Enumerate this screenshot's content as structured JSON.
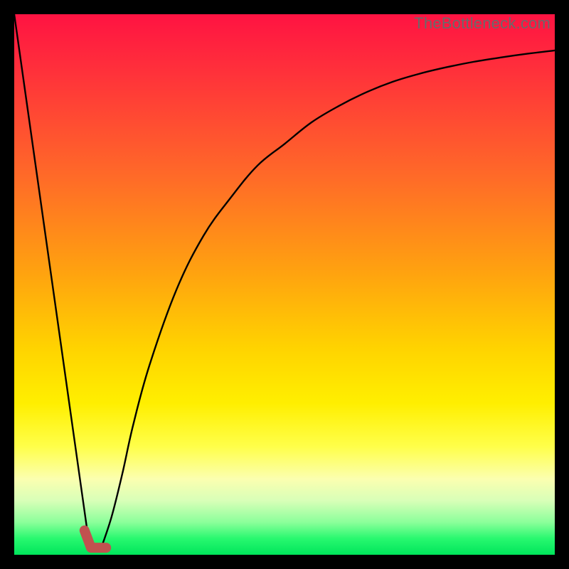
{
  "watermark": "TheBottleneck.com",
  "chart_data": {
    "type": "line",
    "title": "",
    "xlabel": "",
    "ylabel": "",
    "xlim": [
      0,
      100
    ],
    "ylim": [
      0,
      100
    ],
    "grid": false,
    "series": [
      {
        "name": "left-line",
        "x": [
          0,
          14
        ],
        "y": [
          100,
          1
        ]
      },
      {
        "name": "right-curve",
        "x": [
          16,
          18,
          20,
          22,
          25,
          30,
          35,
          40,
          45,
          50,
          55,
          60,
          65,
          70,
          75,
          80,
          85,
          90,
          95,
          100
        ],
        "y": [
          1,
          7,
          15,
          24,
          35,
          49,
          59,
          66,
          72,
          76,
          80,
          83,
          85.5,
          87.5,
          89,
          90.2,
          91.2,
          92,
          92.7,
          93.3
        ]
      }
    ],
    "marker": {
      "name": "highlight-L",
      "points_x": [
        13,
        14.2,
        17
      ],
      "points_y": [
        4.5,
        1.3,
        1.3
      ]
    }
  }
}
